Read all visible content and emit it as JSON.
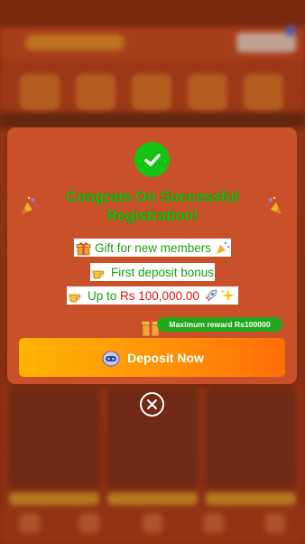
{
  "modal": {
    "title": "Congrats On Successful Registration!",
    "line1_text": "Gift for new members",
    "line2_text": "First deposit bonus",
    "line3_prefix": "Up to ",
    "line3_amount": "Rs 100,000.00",
    "reward_badge": "Maximum reward Rs100000",
    "deposit_button": "Deposit Now",
    "icons": {
      "success": "check-circle-icon",
      "popper": "party-popper-icon",
      "gift": "gift-icon",
      "pointing": "pointing-hand-icon",
      "rocket": "rocket-icon",
      "sparkles": "sparkles-icon",
      "robot": "robot-icon",
      "close": "close-circle-icon"
    },
    "colors": {
      "modal_bg": "#c8512a",
      "title_green": "#1dbb12",
      "amount_red": "#e01515",
      "button_start": "#ffb300",
      "button_end": "#ff6d08",
      "badge_green": "#20a81c"
    }
  }
}
